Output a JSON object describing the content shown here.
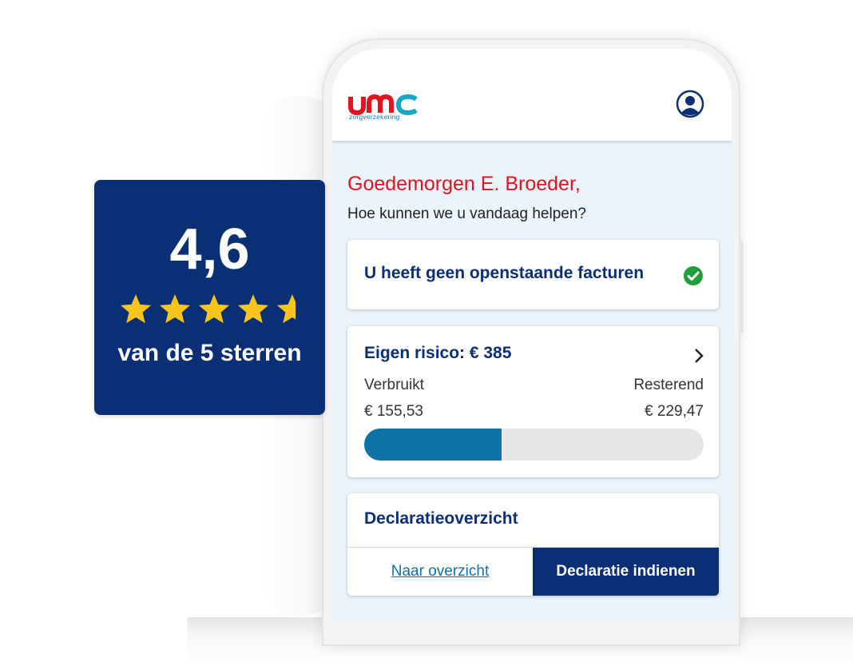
{
  "app": {
    "brand": "umc",
    "brand_tagline": "zorgverzekering",
    "account_icon": "user-circle-icon"
  },
  "greeting": {
    "title": "Goedemorgen E. Broeder,",
    "subtitle": "Hoe kunnen we u vandaag helpen?"
  },
  "invoices": {
    "text": "U heeft geen openstaande facturen",
    "status_icon": "check-circle-icon",
    "status_color": "#1f9e3a"
  },
  "deductible": {
    "title": "Eigen risico: € 385",
    "used_label": "Verbruikt",
    "used_value": "€ 155,53",
    "remaining_label": "Resterend",
    "remaining_value": "€ 229,47",
    "progress_fraction": 0.404,
    "bar_color": "#0d72a4"
  },
  "claims": {
    "title": "Declaratieoverzicht",
    "overview_link": "Naar overzicht",
    "submit_button": "Declaratie indienen"
  },
  "rating": {
    "value": "4,6",
    "caption": "van de 5 sterren",
    "stars": 4.6,
    "star_color": "#f8c51c"
  },
  "colors": {
    "brand_navy": "#0b2f74",
    "brand_red": "#e3121f",
    "brand_teal": "#0d7dab",
    "screen_bg": "#eaf4fa"
  }
}
